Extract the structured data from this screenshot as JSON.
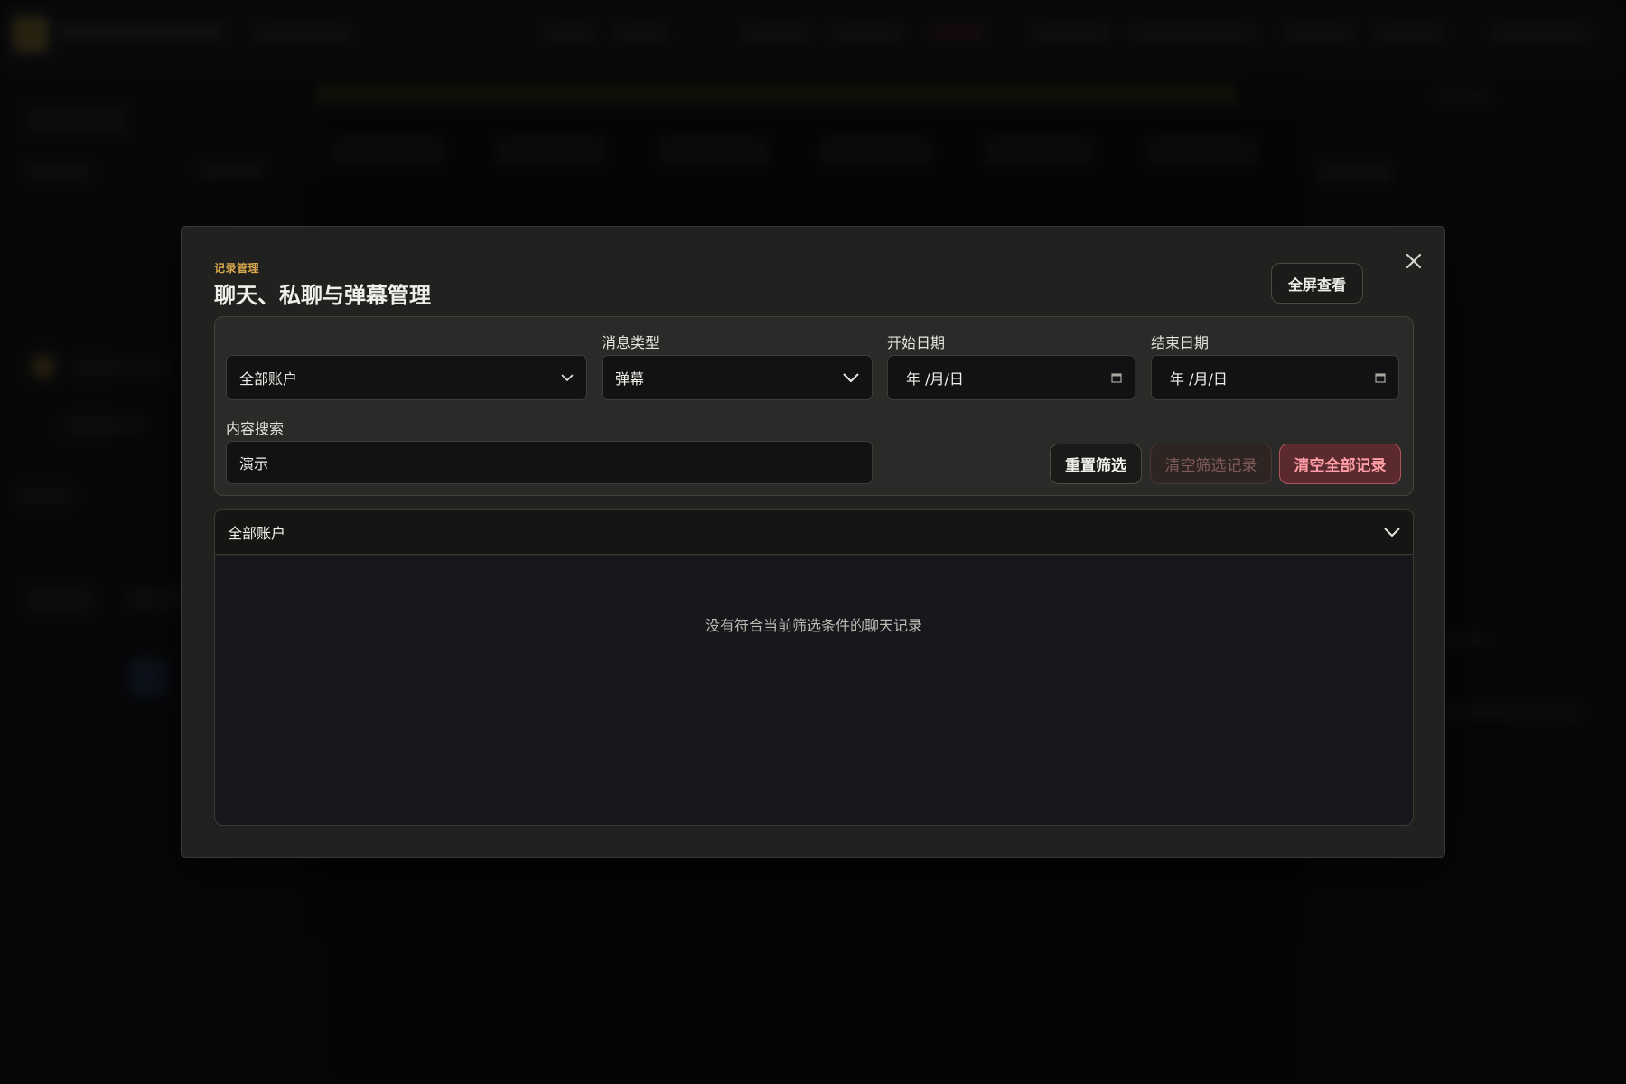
{
  "modal": {
    "eyebrow": "记录管理",
    "title": "聊天、私聊与弹幕管理",
    "fullscreen_label": "全屏查看"
  },
  "filters": {
    "account": {
      "label": "",
      "value": "全部账户"
    },
    "message_type": {
      "label": "消息类型",
      "value": "弹幕"
    },
    "start_date": {
      "label": "开始日期",
      "value": "年 /月/日"
    },
    "end_date": {
      "label": "结束日期",
      "value": "年 /月/日"
    },
    "search": {
      "label": "内容搜索",
      "value": "演示"
    }
  },
  "actions": {
    "reset_label": "重置筛选",
    "clear_filtered_label": "清空筛选记录",
    "clear_all_label": "清空全部记录"
  },
  "records": {
    "account_group_label": "全部账户",
    "empty_message": "没有符合当前筛选条件的聊天记录"
  },
  "colors": {
    "accent": "#d9a84a",
    "danger": "#ff9ea6",
    "panel": "#2a2a28"
  }
}
